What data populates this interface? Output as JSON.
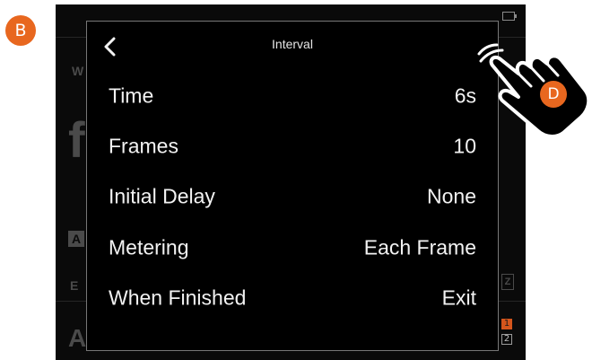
{
  "callouts": {
    "b": "B",
    "d": "D"
  },
  "panel": {
    "title": "Interval",
    "rows": [
      {
        "label": "Time",
        "value": "6s"
      },
      {
        "label": "Frames",
        "value": "10"
      },
      {
        "label": "Initial Delay",
        "value": "None"
      },
      {
        "label": "Metering",
        "value": "Each Frame"
      },
      {
        "label": "When Finished",
        "value": "Exit"
      }
    ]
  },
  "counters": {
    "first": "1",
    "second": "2"
  },
  "icons": {
    "back": "chevron-left-icon",
    "battery": "battery-icon",
    "hand": "pointing-hand-icon"
  },
  "colors": {
    "accent": "#e8671f",
    "panel_bg": "#000000",
    "panel_border": "#777777",
    "text": "#f2f2f2"
  }
}
